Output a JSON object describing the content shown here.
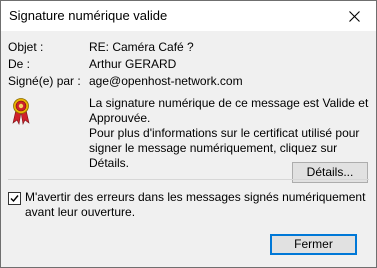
{
  "window": {
    "title": "Signature numérique valide"
  },
  "fields": [
    {
      "label": "Objet :",
      "value": "RE: Caméra Café ?"
    },
    {
      "label": "De :",
      "value": "Arthur GERARD"
    },
    {
      "label": "Signé(e) par :",
      "value": "age@openhost-network.com"
    }
  ],
  "status": {
    "icon": "certificate-ribbon-icon",
    "message": "La signature numérique de ce message est Valide et Approuvée.",
    "info": "Pour plus d'informations sur le certificat utilisé pour signer le message numériquement, cliquez sur Détails."
  },
  "buttons": {
    "details_label": "Détails...",
    "close_label": "Fermer"
  },
  "warn_checkbox": {
    "checked": true,
    "label": "M'avertir des erreurs dans les messages signés numériquement avant leur ouverture."
  },
  "colors": {
    "accent": "#0078d7",
    "ribbon_red": "#d0202a",
    "ribbon_gold": "#e8b400"
  }
}
